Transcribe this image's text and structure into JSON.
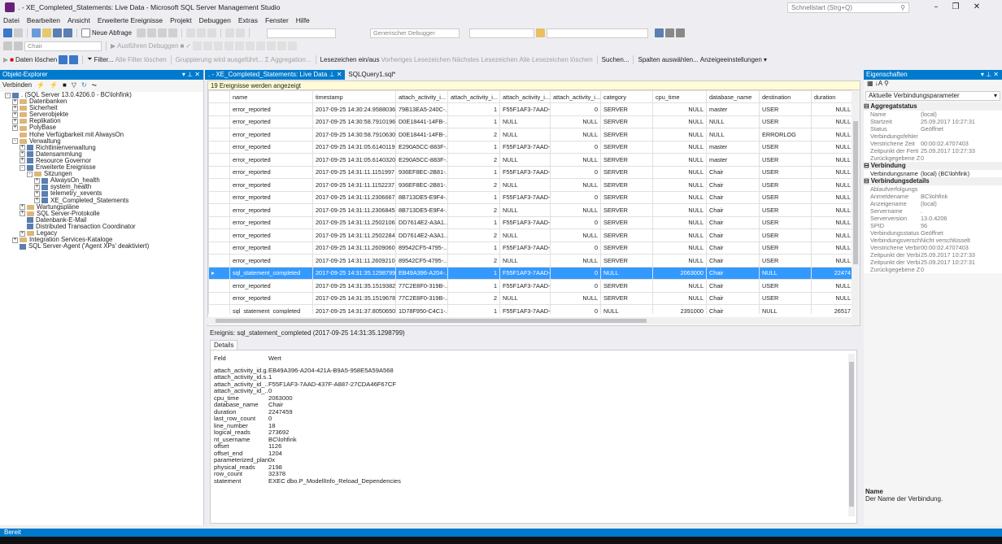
{
  "window": {
    "title": ". - XE_Completed_Statements: Live Data - Microsoft SQL Server Management Studio",
    "quicklaunch_placeholder": "Schnellstart (Strg+Q)"
  },
  "menu": [
    "Datei",
    "Bearbeiten",
    "Ansicht",
    "Erweiterte Ereignisse",
    "Projekt",
    "Debuggen",
    "Extras",
    "Fenster",
    "Hilfe"
  ],
  "toolbar1": {
    "new_query": "Neue Abfrage",
    "debugger": "Generischer Debugger"
  },
  "toolbar2": {
    "db_combo": "Chair",
    "execute": "Ausführen",
    "debug": "Debuggen"
  },
  "toolbar3": {
    "clear": "Daten löschen",
    "filter": "Filter...",
    "clear_filters": "Alle Filter löschen",
    "grouping": "Gruppierung wird ausgeführt...",
    "aggregation": "Aggregation...",
    "bookmarks": "Lesezeichen ein/aus",
    "prev": "Vorheriges Lesezeichen",
    "next": "Nächstes Lesezeichen",
    "clear_bm": "Alle Lesezeichen löschen",
    "search": "Suchen...",
    "columns": "Spalten auswählen...",
    "display": "Anzeigeeinstellungen"
  },
  "object_explorer": {
    "title": "Objekt-Explorer",
    "connect": "Verbinden",
    "nodes": [
      {
        "label": ". (SQL Server 13.0.4206.0 - BC\\lohfink)",
        "level": 0,
        "exp": "-",
        "icon": "server"
      },
      {
        "label": "Datenbanken",
        "level": 1,
        "exp": "+",
        "icon": "folder"
      },
      {
        "label": "Sicherheit",
        "level": 1,
        "exp": "+",
        "icon": "folder"
      },
      {
        "label": "Serverobjekte",
        "level": 1,
        "exp": "+",
        "icon": "folder"
      },
      {
        "label": "Replikation",
        "level": 1,
        "exp": "+",
        "icon": "folder"
      },
      {
        "label": "PolyBase",
        "level": 1,
        "exp": "+",
        "icon": "folder"
      },
      {
        "label": "Hohe Verfügbarkeit mit AlwaysOn",
        "level": 1,
        "exp": "",
        "icon": "folder"
      },
      {
        "label": "Verwaltung",
        "level": 1,
        "exp": "-",
        "icon": "folder"
      },
      {
        "label": "Richtlinienverwaltung",
        "level": 2,
        "exp": "+",
        "icon": "item"
      },
      {
        "label": "Datensammlung",
        "level": 2,
        "exp": "+",
        "icon": "item"
      },
      {
        "label": "Resource Governor",
        "level": 2,
        "exp": "+",
        "icon": "item"
      },
      {
        "label": "Erweiterte Ereignisse",
        "level": 2,
        "exp": "-",
        "icon": "item"
      },
      {
        "label": "Sitzungen",
        "level": 3,
        "exp": "-",
        "icon": "folder"
      },
      {
        "label": "AlwaysOn_health",
        "level": 4,
        "exp": "+",
        "icon": "item"
      },
      {
        "label": "system_health",
        "level": 4,
        "exp": "+",
        "icon": "item"
      },
      {
        "label": "telemetry_xevents",
        "level": 4,
        "exp": "+",
        "icon": "item"
      },
      {
        "label": "XE_Completed_Statements",
        "level": 4,
        "exp": "+",
        "icon": "item"
      },
      {
        "label": "Wartungspläne",
        "level": 2,
        "exp": "+",
        "icon": "folder"
      },
      {
        "label": "SQL Server-Protokolle",
        "level": 2,
        "exp": "+",
        "icon": "folder"
      },
      {
        "label": "Datenbank-E-Mail",
        "level": 2,
        "exp": "",
        "icon": "item"
      },
      {
        "label": "Distributed Transaction Coordinator",
        "level": 2,
        "exp": "",
        "icon": "item"
      },
      {
        "label": "Legacy",
        "level": 2,
        "exp": "+",
        "icon": "folder"
      },
      {
        "label": "Integration Services-Kataloge",
        "level": 1,
        "exp": "+",
        "icon": "folder"
      },
      {
        "label": "SQL Server-Agent ('Agent XPs' deaktiviert)",
        "level": 1,
        "exp": "",
        "icon": "item"
      }
    ]
  },
  "tabs": [
    {
      "label": ". - XE_Completed_Statements: Live Data",
      "active": true
    },
    {
      "label": "SQLQuery1.sql*",
      "active": false
    }
  ],
  "grid": {
    "info": "19 Ereignisse werden angezeigt",
    "columns": [
      "name",
      "timestamp",
      "attach_activity_i...",
      "attach_activity_i...",
      "attach_activity_i...",
      "attach_activity_i...",
      "category",
      "cpu_time",
      "database_name",
      "destination",
      "duration"
    ],
    "rows": [
      [
        "error_reported",
        "2017-09-25 14:30:24.9588036",
        "79B13EA5-240C-...",
        "1",
        "F55F1AF3-7AAD-...",
        "0",
        "SERVER",
        "NULL",
        "master",
        "USER",
        "NULL"
      ],
      [
        "error_reported",
        "2017-09-25 14:30:58.7910196",
        "D0E18441-14FB-...",
        "1",
        "NULL",
        "NULL",
        "SERVER",
        "NULL",
        "NULL",
        "USER",
        "NULL"
      ],
      [
        "error_reported",
        "2017-09-25 14:30:58.7910630",
        "D0E18441-14FB-...",
        "2",
        "NULL",
        "NULL",
        "SERVER",
        "NULL",
        "NULL",
        "ERRORLOG",
        "NULL"
      ],
      [
        "error_reported",
        "2017-09-25 14:31:05.6140119",
        "E290A5CC-883F-...",
        "1",
        "F55F1AF3-7AAD-...",
        "0",
        "SERVER",
        "NULL",
        "master",
        "USER",
        "NULL"
      ],
      [
        "error_reported",
        "2017-09-25 14:31:05.6140320",
        "E290A5CC-883F-...",
        "2",
        "NULL",
        "NULL",
        "SERVER",
        "NULL",
        "master",
        "USER",
        "NULL"
      ],
      [
        "error_reported",
        "2017-09-25 14:31:11.1151997",
        "936EF8EC-2B81-...",
        "1",
        "F55F1AF3-7AAD-...",
        "0",
        "SERVER",
        "NULL",
        "Chair",
        "USER",
        "NULL"
      ],
      [
        "error_reported",
        "2017-09-25 14:31:11.1152237",
        "936EF8EC-2B81-...",
        "2",
        "NULL",
        "NULL",
        "SERVER",
        "NULL",
        "Chair",
        "USER",
        "NULL"
      ],
      [
        "error_reported",
        "2017-09-25 14:31:11.2306667",
        "8B713DE5-E9F4-...",
        "1",
        "F55F1AF3-7AAD-...",
        "0",
        "SERVER",
        "NULL",
        "Chair",
        "USER",
        "NULL"
      ],
      [
        "error_reported",
        "2017-09-25 14:31:11.2306845",
        "8B713DE5-E9F4-...",
        "2",
        "NULL",
        "NULL",
        "SERVER",
        "NULL",
        "Chair",
        "USER",
        "NULL"
      ],
      [
        "error_reported",
        "2017-09-25 14:31:11.2502106",
        "DD7614E2-A3A1...",
        "1",
        "F55F1AF3-7AAD-...",
        "0",
        "SERVER",
        "NULL",
        "Chair",
        "USER",
        "NULL"
      ],
      [
        "error_reported",
        "2017-09-25 14:31:11.2502284",
        "DD7614E2-A3A1...",
        "2",
        "NULL",
        "NULL",
        "SERVER",
        "NULL",
        "Chair",
        "USER",
        "NULL"
      ],
      [
        "error_reported",
        "2017-09-25 14:31:11.2609060",
        "89542CF5-4795-...",
        "1",
        "F55F1AF3-7AAD-...",
        "0",
        "SERVER",
        "NULL",
        "Chair",
        "USER",
        "NULL"
      ],
      [
        "error_reported",
        "2017-09-25 14:31:11.2609210",
        "89542CF5-4795-...",
        "2",
        "NULL",
        "NULL",
        "SERVER",
        "NULL",
        "Chair",
        "USER",
        "NULL"
      ],
      [
        "sql_statement_completed",
        "2017-09-25 14:31:35.1298799",
        "EB49A396-A204-...",
        "1",
        "F55F1AF3-7AAD-...",
        "0",
        "NULL",
        "2063000",
        "Chair",
        "NULL",
        "22474"
      ],
      [
        "error_reported",
        "2017-09-25 14:31:35.1519382",
        "77C2E8F0-319B-...",
        "1",
        "F55F1AF3-7AAD-...",
        "0",
        "SERVER",
        "NULL",
        "Chair",
        "USER",
        "NULL"
      ],
      [
        "error_reported",
        "2017-09-25 14:31:35.1519678",
        "77C2E8F0-319B-...",
        "2",
        "NULL",
        "NULL",
        "SERVER",
        "NULL",
        "Chair",
        "USER",
        "NULL"
      ],
      [
        "sql_statement_completed",
        "2017-09-25 14:31:37.8050650",
        "1D78F950-C4C1-...",
        "1",
        "F55F1AF3-7AAD-...",
        "0",
        "NULL",
        "2391000",
        "Chair",
        "NULL",
        "26517"
      ]
    ],
    "selected_row": 13
  },
  "event_label": "Ereignis: sql_statement_completed (2017-09-25 14:31:35.1298799)",
  "details": {
    "tab": "Details",
    "col_field": "Feld",
    "col_value": "Wert",
    "rows": [
      [
        "attach_activity_id.g...",
        "EB49A396-A204-421A-B9A5-958E5A59A568"
      ],
      [
        "attach_activity_id.s...",
        "1"
      ],
      [
        "attach_activity_id_...",
        "F55F1AF3-7AAD-437F-A887-27CDA46F67CF"
      ],
      [
        "attach_activity_id_...",
        "0"
      ],
      [
        "cpu_time",
        "2063000"
      ],
      [
        "database_name",
        "Chair"
      ],
      [
        "duration",
        "2247459"
      ],
      [
        "last_row_count",
        "0"
      ],
      [
        "line_number",
        "18"
      ],
      [
        "logical_reads",
        "273692"
      ],
      [
        "nt_username",
        "BC\\lohfink"
      ],
      [
        "offset",
        "1126"
      ],
      [
        "offset_end",
        "1204"
      ],
      [
        "parameterized_plan...",
        "0x"
      ],
      [
        "physical_reads",
        "2198"
      ],
      [
        "row_count",
        "32378"
      ],
      [
        "statement",
        "EXEC dbo.P_ModellInfo_Reload_Dependencies"
      ]
    ]
  },
  "properties": {
    "title": "Eigenschaften",
    "combo": "Aktuelle Verbindungsparameter",
    "sections": [
      {
        "name": "Aggregatstatus",
        "rows": [
          [
            "Name",
            "(local)"
          ],
          [
            "Startzeit",
            "25.09.2017 10:27:31"
          ],
          [
            "Status",
            "Geöffnet"
          ],
          [
            "Verbindungsfehler",
            ""
          ],
          [
            "Verstrichene Zeit",
            "00:00:02.4707403"
          ],
          [
            "Zeitpunkt der Ferti",
            "25.09.2017 10:27:33"
          ],
          [
            "Zurückgegebene Z",
            "0"
          ]
        ]
      },
      {
        "name": "Verbindung",
        "rows": [
          [
            "Verbindungsname",
            "(local) (BC\\lohfink)"
          ]
        ]
      },
      {
        "name": "Verbindungsdetails",
        "rows": [
          [
            "Ablaufverfolgungs",
            ""
          ],
          [
            "Anmeldename",
            "BC\\lohfink"
          ],
          [
            "Anzeigename",
            "(local)"
          ],
          [
            "Servername",
            "."
          ],
          [
            "Serverversion",
            "13.0.4206"
          ],
          [
            "SPID",
            "56"
          ],
          [
            "Verbindungsstatus",
            "Geöffnet"
          ],
          [
            "Verbindungsversch",
            "Nicht verschlüsselt"
          ],
          [
            "Verstrichene Verbin",
            "00:00:02.4707403"
          ],
          [
            "Zeitpunkt der Verbi",
            "25.09.2017 10:27:33"
          ],
          [
            "Zeitpunkt der Verbi",
            "25.09.2017 10:27:31"
          ],
          [
            "Zurückgegebene Z",
            "0"
          ]
        ]
      }
    ],
    "desc_title": "Name",
    "desc_text": "Der Name der Verbindung."
  },
  "statusbar": "Bereit"
}
